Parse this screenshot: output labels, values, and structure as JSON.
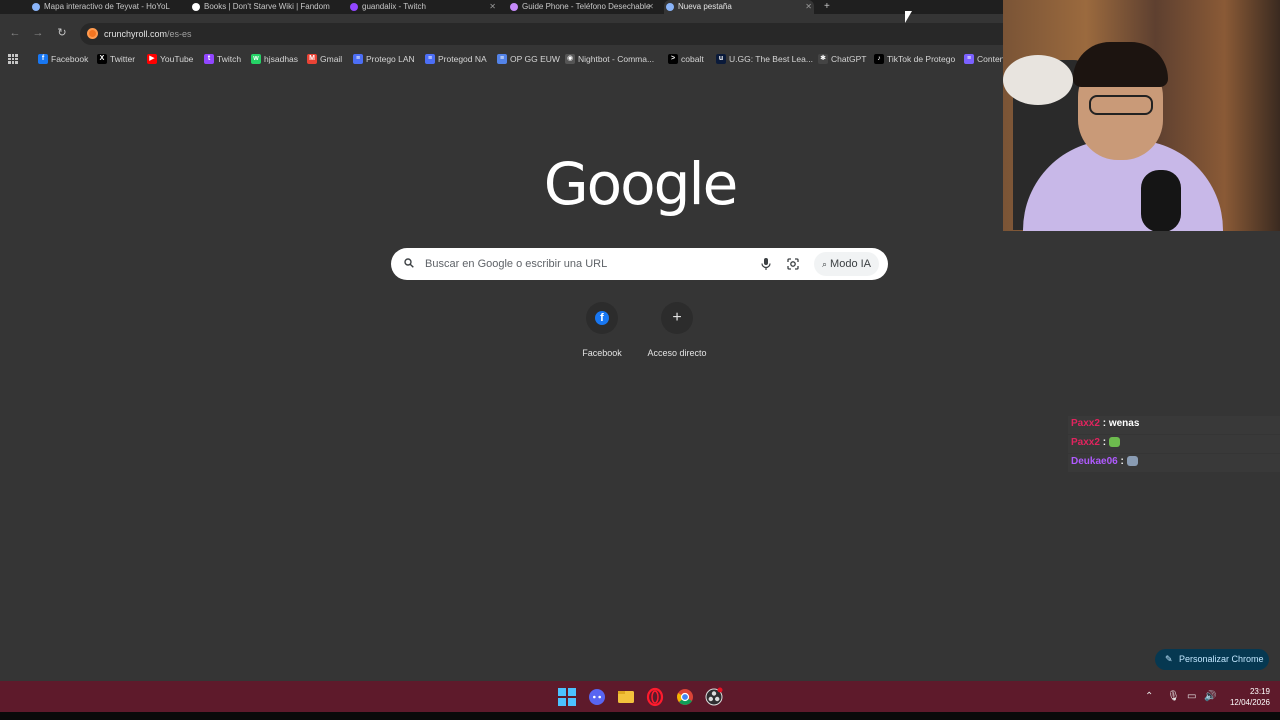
{
  "browser": {
    "tabs": [
      {
        "title": "Mapa interactivo de Teyvat - HoYoLAB",
        "favicon_color": "#8ab4f8"
      },
      {
        "title": "Books | Don't Starve Wiki | Fandom",
        "favicon_color": "#ffffff"
      },
      {
        "title": "guandalix - Twitch",
        "favicon_color": "#9146ff"
      },
      {
        "title": "Guide Phone - Teléfono Desechable",
        "favicon_color": "#c58af9"
      },
      {
        "title": "Nueva pestaña",
        "favicon_color": "#8ab4f8",
        "active": true
      }
    ],
    "new_tab_label": "+",
    "url_host": "crunchyroll.com",
    "url_path": "/es-es",
    "bookmarks": [
      {
        "label": "Facebook",
        "icon": "facebook-icon",
        "color": "#1877f2",
        "glyph": "f"
      },
      {
        "label": "Twitter",
        "icon": "x-icon",
        "color": "#000000",
        "glyph": "X"
      },
      {
        "label": "YouTube",
        "icon": "youtube-icon",
        "color": "#ff0000",
        "glyph": "▶"
      },
      {
        "label": "Twitch",
        "icon": "twitch-icon",
        "color": "#9146ff",
        "glyph": "t"
      },
      {
        "label": "hjsadhas",
        "icon": "whatsapp-icon",
        "color": "#25d366",
        "glyph": "w"
      },
      {
        "label": "Gmail",
        "icon": "gmail-icon",
        "color": "#ea4335",
        "glyph": "M"
      },
      {
        "label": "Protego LAN",
        "icon": "doc-icon",
        "color": "#4c6ef5",
        "glyph": "≡"
      },
      {
        "label": "Protegod NA",
        "icon": "doc-icon",
        "color": "#4c6ef5",
        "glyph": "≡"
      },
      {
        "label": "OP GG EUW",
        "icon": "opgg-icon",
        "color": "#5383e8",
        "glyph": "≡"
      },
      {
        "label": "Nightbot - Comma...",
        "icon": "nightbot-icon",
        "color": "#555555",
        "glyph": "◉"
      },
      {
        "label": "cobalt",
        "icon": "cobalt-icon",
        "color": "#000000",
        "glyph": ">"
      },
      {
        "label": "U.GG: The Best Lea...",
        "icon": "ugg-icon",
        "color": "#0a1a3a",
        "glyph": "u"
      },
      {
        "label": "ChatGPT",
        "icon": "chatgpt-icon",
        "color": "#444444",
        "glyph": "✱"
      },
      {
        "label": "TikTok de Protego",
        "icon": "tiktok-icon",
        "color": "#000000",
        "glyph": "♪"
      },
      {
        "label": "Conten",
        "icon": "list-icon",
        "color": "#7b61ff",
        "glyph": "≡"
      }
    ]
  },
  "google": {
    "logo": "Google",
    "search_placeholder": "Buscar en Google o escribir una URL",
    "ai_mode_label": "Modo IA",
    "shortcuts": [
      {
        "label": "Facebook"
      },
      {
        "label": "Acceso directo"
      }
    ],
    "customize_label": "Personalizar Chrome"
  },
  "chat": {
    "messages": [
      {
        "user": "Paxx2",
        "user_color": "#e0245e",
        "text": "wenas",
        "emote": false
      },
      {
        "user": "Paxx2",
        "user_color": "#e0245e",
        "text": "",
        "emote": true,
        "emote_color": "#6dbb4e"
      },
      {
        "user": "Deukae06",
        "user_color": "#b05aff",
        "text": "",
        "emote": true,
        "emote_color": "#8a9cb3"
      }
    ]
  },
  "taskbar": {
    "time": "23:19",
    "date": "12/04/2026",
    "accent": "#5e1a2b"
  }
}
